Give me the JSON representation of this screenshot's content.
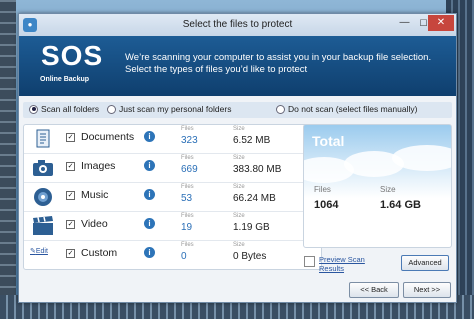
{
  "window": {
    "title": "Select the files to protect"
  },
  "header": {
    "logo_main": "SOS",
    "logo_sub": "Online Backup",
    "intro_line1": "We’re scanning your computer to assist you in your backup file selection.",
    "intro_line2": "Select the types of files you’d like to protect"
  },
  "scan_options": {
    "selected": "Scan all folders",
    "items": [
      "Scan all folders",
      "Just scan my personal folders",
      "Do not scan (select files manually)"
    ]
  },
  "labels": {
    "files": "Files",
    "size": "Size",
    "edit": "Edit"
  },
  "categories": [
    {
      "name": "Documents",
      "checked": true,
      "files": "323",
      "size": "6.52 MB",
      "icon": "document-icon"
    },
    {
      "name": "Images",
      "checked": true,
      "files": "669",
      "size": "383.80 MB",
      "icon": "camera-icon"
    },
    {
      "name": "Music",
      "checked": true,
      "files": "53",
      "size": "66.24 MB",
      "icon": "disc-icon"
    },
    {
      "name": "Video",
      "checked": true,
      "files": "19",
      "size": "1.19 GB",
      "icon": "clapperboard-icon"
    },
    {
      "name": "Custom",
      "checked": true,
      "files": "0",
      "size": "0 Bytes",
      "icon": "edit-icon"
    }
  ],
  "total": {
    "title": "Total",
    "files_label": "Files",
    "files": "1064",
    "size_label": "Size",
    "size": "1.64 GB"
  },
  "buttons": {
    "preview": "Preview Scan Results",
    "advanced": "Advanced",
    "back": "<< Back",
    "next": "Next >>"
  },
  "colors": {
    "header": "#1d5c95",
    "accent": "#2a6fb7"
  }
}
